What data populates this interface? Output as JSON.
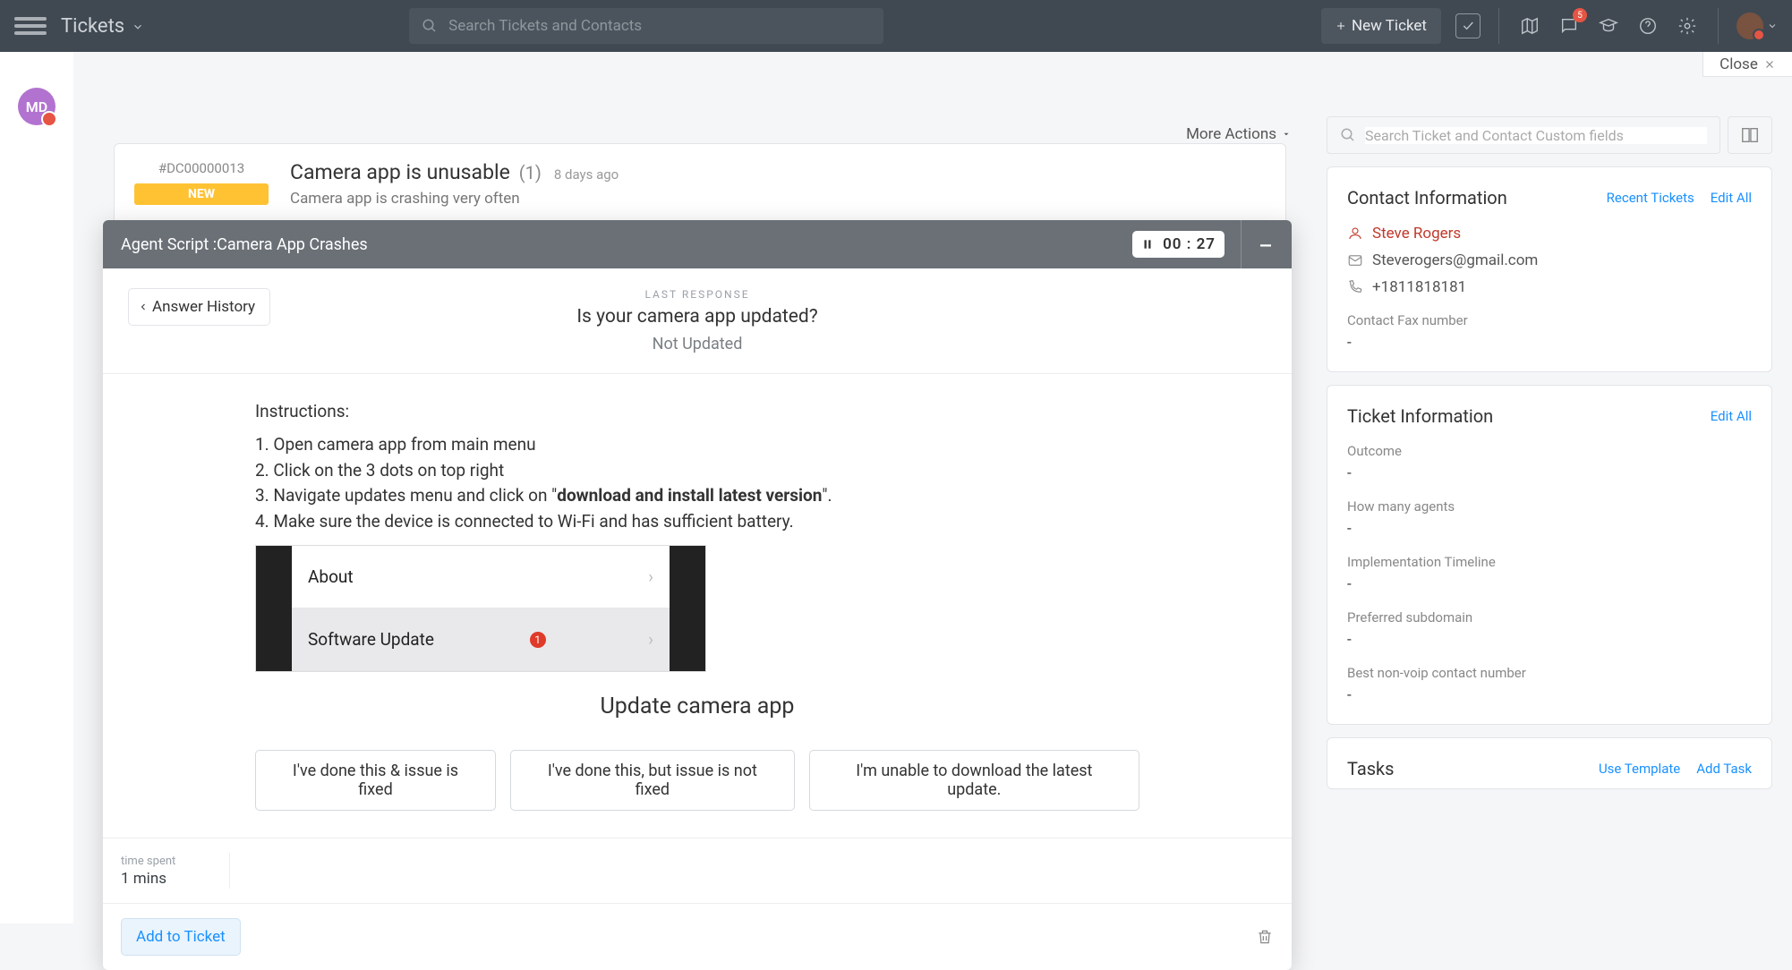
{
  "topbar": {
    "title": "Tickets",
    "searchPlaceholder": "Search Tickets and Contacts",
    "newTicket": "New Ticket",
    "notifCount": "5",
    "close": "Close"
  },
  "leftRail": {
    "avatarInitials": "MD"
  },
  "moreActions": "More Actions",
  "ticket": {
    "id": "#DC00000013",
    "status": "NEW",
    "title": "Camera app is unusable",
    "count": "(1)",
    "timeAgo": "8 days ago",
    "subtitle": "Camera app is crashing very often"
  },
  "sidebar": {
    "searchPlaceholder": "Search Ticket and Contact Custom fields"
  },
  "contact": {
    "panelTitle": "Contact Information",
    "recent": "Recent Tickets",
    "editAll": "Edit All",
    "name": "Steve Rogers",
    "email": "Steverogers@gmail.com",
    "phone": "+1811818181",
    "faxLabel": "Contact Fax number",
    "faxValue": "-"
  },
  "ticketInfo": {
    "panelTitle": "Ticket Information",
    "editAll": "Edit All",
    "fields": [
      {
        "label": "Outcome",
        "value": "-"
      },
      {
        "label": "How many agents",
        "value": "-"
      },
      {
        "label": "Implementation Timeline",
        "value": "-"
      },
      {
        "label": "Preferred subdomain",
        "value": "-"
      },
      {
        "label": "Best non-voip contact number",
        "value": "-"
      }
    ]
  },
  "tasks": {
    "title": "Tasks",
    "useTemplate": "Use Template",
    "addTask": "Add Task"
  },
  "modal": {
    "headerPrefix": "Agent Script : ",
    "headerName": "Camera App Crashes",
    "timer": "00 : 27",
    "answerHistory": "Answer History",
    "lastResponseLabel": "LAST RESPONSE",
    "question": "Is your camera app updated?",
    "answer": "Not Updated",
    "instructionsTitle": "Instructions:",
    "steps": [
      "1. Open camera app from main menu",
      "2. Click on the 3 dots on top right",
      "3. Navigate updates menu and click on \"",
      "4. Make sure the device is connected to Wi-Fi and has sufficient battery."
    ],
    "bold": "download and install latest version",
    "boldSuffix": "\".",
    "phone": {
      "row1": "About",
      "row2": "Software Update",
      "badge": "1"
    },
    "stepTitle": "Update camera app",
    "options": [
      "I've done this & issue is fixed",
      "I've done this, but issue is not fixed",
      "I'm unable to download the latest update."
    ],
    "timeSpentLabel": "time spent",
    "timeSpentValue": "1 mins",
    "addToTicket": "Add to Ticket"
  },
  "bottom": {
    "timeSpent": "time spent"
  }
}
